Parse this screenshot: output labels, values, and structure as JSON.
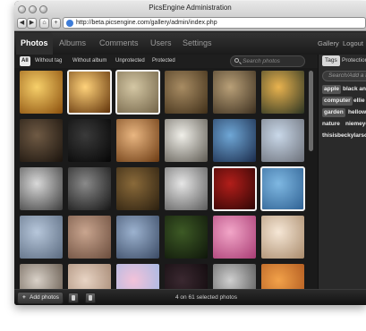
{
  "window": {
    "title": "PicsEngine Administration"
  },
  "browser": {
    "back": "◀",
    "forward": "▶",
    "home": "⌂",
    "add": "+",
    "url": "http://beta.picsengine.com/gallery/admin/index.php"
  },
  "nav": {
    "tabs": [
      "Photos",
      "Albums",
      "Comments",
      "Users",
      "Settings"
    ],
    "active": "Photos",
    "gallery_link": "Gallery",
    "logout_link": "Logout"
  },
  "filters": {
    "items": [
      "All",
      "Without tag",
      "Without album",
      "Unprotected",
      "Protected"
    ],
    "active": "All"
  },
  "search": {
    "placeholder": "Search photos"
  },
  "sidebar": {
    "tabs": [
      "Tags",
      "Protection"
    ],
    "active": "Tags",
    "add_placeholder": "Search/Add a t",
    "tags": [
      "apple",
      "black and",
      "computer",
      "ellie",
      "garden",
      "hellowi",
      "nature",
      "niemeye",
      "thisisbeckylarso"
    ]
  },
  "footer": {
    "add_label": "Add photos",
    "add_icon": "+",
    "status": "4 on 61 selected photos"
  },
  "photos": [
    {
      "name": "laptop on desk",
      "colors": [
        "#f7d06a",
        "#8a4e0c"
      ],
      "selected": false
    },
    {
      "name": "laptop glow",
      "colors": [
        "#ffd27a",
        "#5a2c05"
      ],
      "selected": true
    },
    {
      "name": "sleeping cat",
      "colors": [
        "#d4c7a4",
        "#6f6044"
      ],
      "selected": true
    },
    {
      "name": "cat face",
      "colors": [
        "#a88c63",
        "#3f2e18"
      ],
      "selected": false
    },
    {
      "name": "tabby cat",
      "colors": [
        "#b9a078",
        "#3c2f1f"
      ],
      "selected": false
    },
    {
      "name": "sunset water",
      "colors": [
        "#e9b34f",
        "#2a3322"
      ],
      "selected": false
    },
    {
      "name": "dark corridor",
      "colors": [
        "#6f5a44",
        "#1a130d"
      ],
      "selected": false
    },
    {
      "name": "glass sphere",
      "colors": [
        "#3a3a3a",
        "#050505"
      ],
      "selected": false
    },
    {
      "name": "orange leaves",
      "colors": [
        "#e9b681",
        "#6b3a12"
      ],
      "selected": false
    },
    {
      "name": "white dog",
      "colors": [
        "#f0efe9",
        "#5e5a52"
      ],
      "selected": false
    },
    {
      "name": "butterfly",
      "colors": [
        "#6fa7d6",
        "#1a2b4b"
      ],
      "selected": false
    },
    {
      "name": "baby smile",
      "colors": [
        "#c9d8e9",
        "#6b6f78"
      ],
      "selected": false
    },
    {
      "name": "child portrait",
      "colors": [
        "#d9d9d9",
        "#3c3c3c"
      ],
      "selected": false
    },
    {
      "name": "girl looking up",
      "colors": [
        "#8a8a8a",
        "#151515"
      ],
      "selected": false
    },
    {
      "name": "wooden door",
      "colors": [
        "#8a6a3a",
        "#2b1f0f"
      ],
      "selected": false
    },
    {
      "name": "smiling woman",
      "colors": [
        "#e6e6e6",
        "#5a5a5a"
      ],
      "selected": false
    },
    {
      "name": "red fabric",
      "colors": [
        "#b21e1a",
        "#2a0504"
      ],
      "selected": true
    },
    {
      "name": "baby in blue",
      "colors": [
        "#7fb8e2",
        "#2c5e90"
      ],
      "selected": true
    },
    {
      "name": "face paint boy",
      "colors": [
        "#b7c7db",
        "#5a6a7f"
      ],
      "selected": false
    },
    {
      "name": "face paint kid",
      "colors": [
        "#c9a58f",
        "#6a4c3c"
      ],
      "selected": false
    },
    {
      "name": "painted face",
      "colors": [
        "#9cb2cf",
        "#3a4a64"
      ],
      "selected": false
    },
    {
      "name": "grasshopper",
      "colors": [
        "#3d5a25",
        "#0e150a"
      ],
      "selected": false
    },
    {
      "name": "pink flower",
      "colors": [
        "#f2a6c8",
        "#a83b73"
      ],
      "selected": false
    },
    {
      "name": "baby face",
      "colors": [
        "#f6e7d6",
        "#a88a6b"
      ],
      "selected": false
    },
    {
      "name": "pale portrait",
      "colors": [
        "#d9d1c8",
        "#584c40"
      ],
      "selected": false
    },
    {
      "name": "soft blur",
      "colors": [
        "#e8d4c4",
        "#9d7f6a"
      ],
      "selected": false
    },
    {
      "name": "pastel stripes",
      "colors": [
        "#f3c2d9",
        "#9ab8e6"
      ],
      "selected": false
    },
    {
      "name": "dark flower",
      "colors": [
        "#3a2830",
        "#0c0709"
      ],
      "selected": false
    },
    {
      "name": "child outdoors",
      "colors": [
        "#cfcfcf",
        "#4a4a4a"
      ],
      "selected": false
    },
    {
      "name": "orange blossom",
      "colors": [
        "#f2a24a",
        "#a8501a"
      ],
      "selected": false
    }
  ]
}
